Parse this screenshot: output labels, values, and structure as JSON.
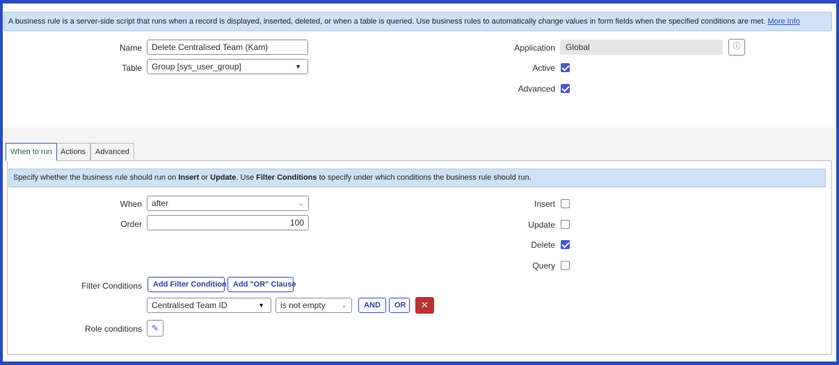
{
  "banner": {
    "text": "A business rule is a server-side script that runs when a record is displayed, inserted, deleted, or when a table is queried. Use business rules to automatically change values in form fields when the specified conditions are met.",
    "link": "More Info"
  },
  "form": {
    "name_label": "Name",
    "name_value": "Delete Centralised Team (Kam)",
    "table_label": "Table",
    "table_value": "Group [sys_user_group]",
    "application_label": "Application",
    "application_value": "Global",
    "active_label": "Active",
    "active_checked": true,
    "advanced_label": "Advanced",
    "advanced_checked": true
  },
  "tabs": [
    {
      "label": "When to run",
      "active": true
    },
    {
      "label": "Actions",
      "active": false
    },
    {
      "label": "Advanced",
      "active": false
    }
  ],
  "when_panel": {
    "banner_part1": "Specify whether the business rule should run on ",
    "banner_insert": "Insert",
    "banner_part2": " or ",
    "banner_update": "Update",
    "banner_part3": ". Use ",
    "banner_filter": "Filter Conditions",
    "banner_part4": " to specify under which conditions the business rule should run.",
    "when_label": "When",
    "when_value": "after",
    "order_label": "Order",
    "order_value": "100",
    "insert_label": "Insert",
    "insert_checked": false,
    "update_label": "Update",
    "update_checked": false,
    "delete_label": "Delete",
    "delete_checked": true,
    "query_label": "Query",
    "query_checked": false,
    "filter_label": "Filter Conditions",
    "add_filter_button": "Add Filter Condition",
    "add_or_button": "Add \"OR\" Clause",
    "condition_field": "Centralised Team ID",
    "condition_operator": "is not empty",
    "and_button": "AND",
    "or_button": "OR",
    "role_label": "Role conditions"
  },
  "colors": {
    "accent": "#4a56c8",
    "frame": "#2a4bc0",
    "banner": "#cfe1f5",
    "delete": "#b63434"
  },
  "icons": {
    "info": "info-circle-icon",
    "caret": "caret-down-icon",
    "chevron": "chevron-down-icon",
    "delete": "close-icon",
    "pencil": "pencil-icon"
  }
}
